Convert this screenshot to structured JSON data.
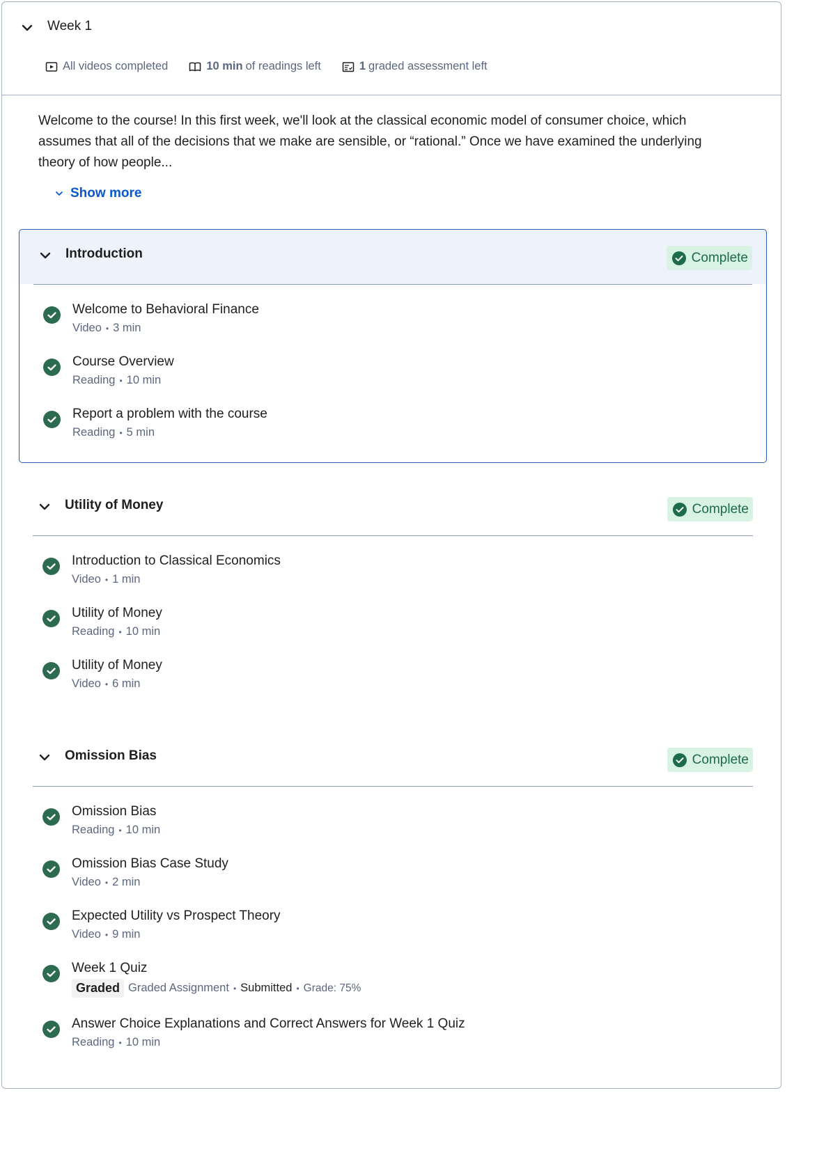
{
  "week": {
    "title": "Week 1",
    "meta": {
      "videos": "All videos completed",
      "readings_bold": "10 min",
      "readings_rest": "of readings left",
      "assess_bold": "1",
      "assess_rest": "graded assessment left"
    },
    "description": "Welcome to the course! In this first week, we'll look at the classical economic model of consumer choice, which assumes that all of the decisions that we make are sensible, or “rational.” Once we have examined the underlying theory of how people...",
    "show_more": "Show more"
  },
  "modules": [
    {
      "title": "Introduction",
      "status": "Complete",
      "items": [
        {
          "title": "Welcome to Behavioral Finance",
          "type": "Video",
          "duration": "3 min"
        },
        {
          "title": "Course Overview",
          "type": "Reading",
          "duration": "10 min"
        },
        {
          "title": "Report a problem with the course",
          "type": "Reading",
          "duration": "5 min"
        }
      ]
    },
    {
      "title": "Utility of Money",
      "status": "Complete",
      "items": [
        {
          "title": "Introduction to Classical Economics",
          "type": "Video",
          "duration": "1 min"
        },
        {
          "title": "Utility of Money",
          "type": "Reading",
          "duration": "10 min"
        },
        {
          "title": "Utility of Money",
          "type": "Video",
          "duration": "6 min"
        }
      ]
    },
    {
      "title": "Omission Bias",
      "status": "Complete",
      "items": [
        {
          "title": "Omission Bias",
          "type": "Reading",
          "duration": "10 min"
        },
        {
          "title": "Omission Bias Case Study",
          "type": "Video",
          "duration": "2 min"
        },
        {
          "title": "Expected Utility vs Prospect Theory",
          "type": "Video",
          "duration": "9 min"
        },
        {
          "title": "Week 1 Quiz",
          "tag": "Graded",
          "type": "Graded Assignment",
          "state": "Submitted",
          "grade": "Grade: 75%"
        },
        {
          "title": "Answer Choice Explanations and Correct Answers for Week 1 Quiz",
          "type": "Reading",
          "duration": "10 min"
        }
      ]
    }
  ],
  "colors": {
    "accent": "#0b57d0",
    "complete_green": "#1d6b4a",
    "complete_bg": "#d8f3e3",
    "active_border": "#2a5cb3",
    "active_bg": "#eef3fb"
  }
}
